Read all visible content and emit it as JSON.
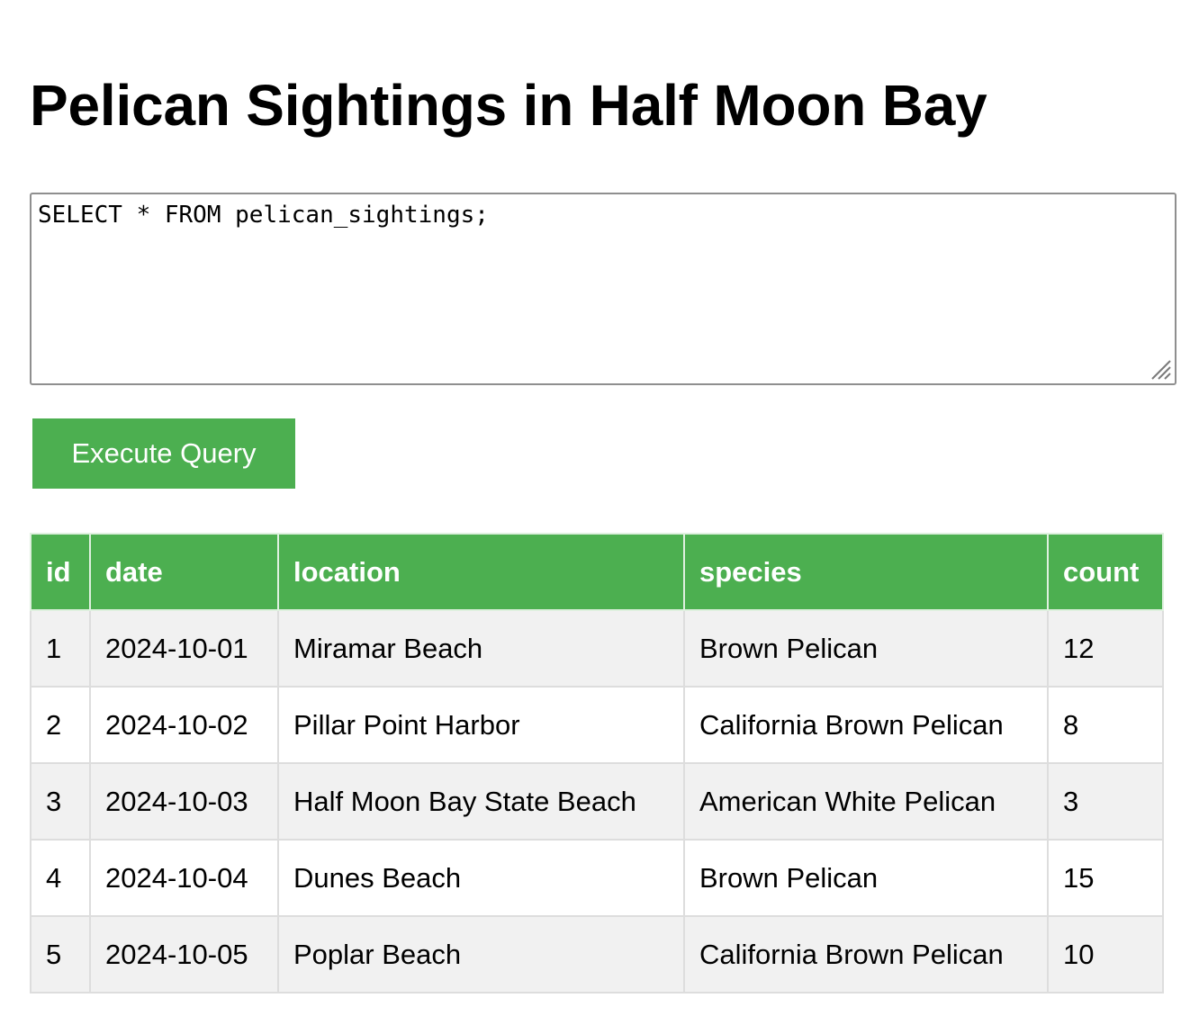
{
  "page": {
    "title": "Pelican Sightings in Half Moon Bay"
  },
  "query": {
    "value": "SELECT * FROM pelican_sightings;"
  },
  "toolbar": {
    "execute_label": "Execute Query"
  },
  "colors": {
    "accent": "#4caf50",
    "row_alt": "#f1f1f1",
    "border": "#dddddd"
  },
  "results": {
    "columns": [
      "id",
      "date",
      "location",
      "species",
      "count"
    ],
    "rows": [
      [
        "1",
        "2024-10-01",
        "Miramar Beach",
        "Brown Pelican",
        "12"
      ],
      [
        "2",
        "2024-10-02",
        "Pillar Point Harbor",
        "California Brown Pelican",
        "8"
      ],
      [
        "3",
        "2024-10-03",
        "Half Moon Bay State Beach",
        "American White Pelican",
        "3"
      ],
      [
        "4",
        "2024-10-04",
        "Dunes Beach",
        "Brown Pelican",
        "15"
      ],
      [
        "5",
        "2024-10-05",
        "Poplar Beach",
        "California Brown Pelican",
        "10"
      ]
    ]
  }
}
